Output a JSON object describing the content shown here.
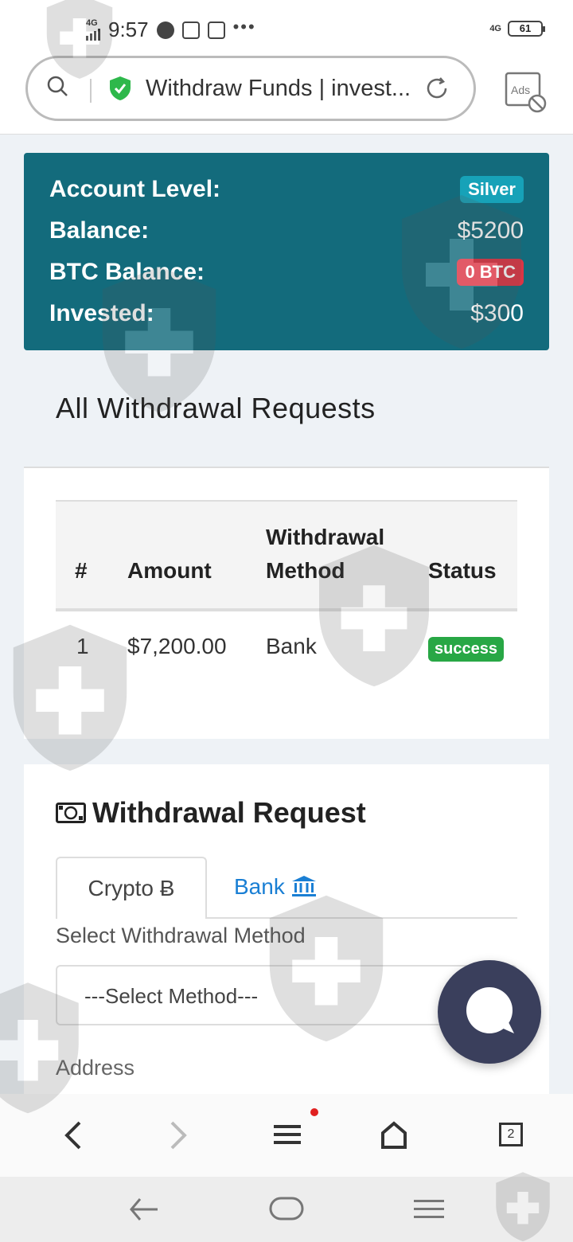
{
  "status_bar": {
    "network": "4G",
    "time": "9:57",
    "network_right": "4G",
    "battery": "61"
  },
  "browser": {
    "url_title": "Withdraw Funds | invest...",
    "ads_label": "Ads",
    "tab_count": "2"
  },
  "account": {
    "level_label": "Account Level:",
    "level_value": "Silver",
    "balance_label": "Balance:",
    "balance_value": "$5200",
    "btc_label": "BTC Balance:",
    "btc_value": "0 BTC",
    "invested_label": "Invested:",
    "invested_value": "$300"
  },
  "history": {
    "title": "All Withdrawal Requests",
    "columns": [
      "#",
      "Amount",
      "Withdrawal",
      "Method",
      "Status"
    ],
    "rows": [
      {
        "num": "1",
        "amount": "$7,200.00",
        "method": "Bank",
        "status": "success"
      }
    ]
  },
  "request": {
    "title": "Withdrawal Request",
    "tab_crypto": "Crypto Ƀ",
    "tab_bank": "Bank",
    "select_label": "Select Withdrawal Method",
    "select_value": "---Select Method---",
    "address_label": "Address"
  },
  "colors": {
    "account_bg": "#136b7c",
    "silver_badge": "#17a2b8",
    "btc_badge": "#dc3545",
    "success_badge": "#28a745",
    "link_blue": "#1a7fd4",
    "chat_bg": "#3a3f5c"
  }
}
